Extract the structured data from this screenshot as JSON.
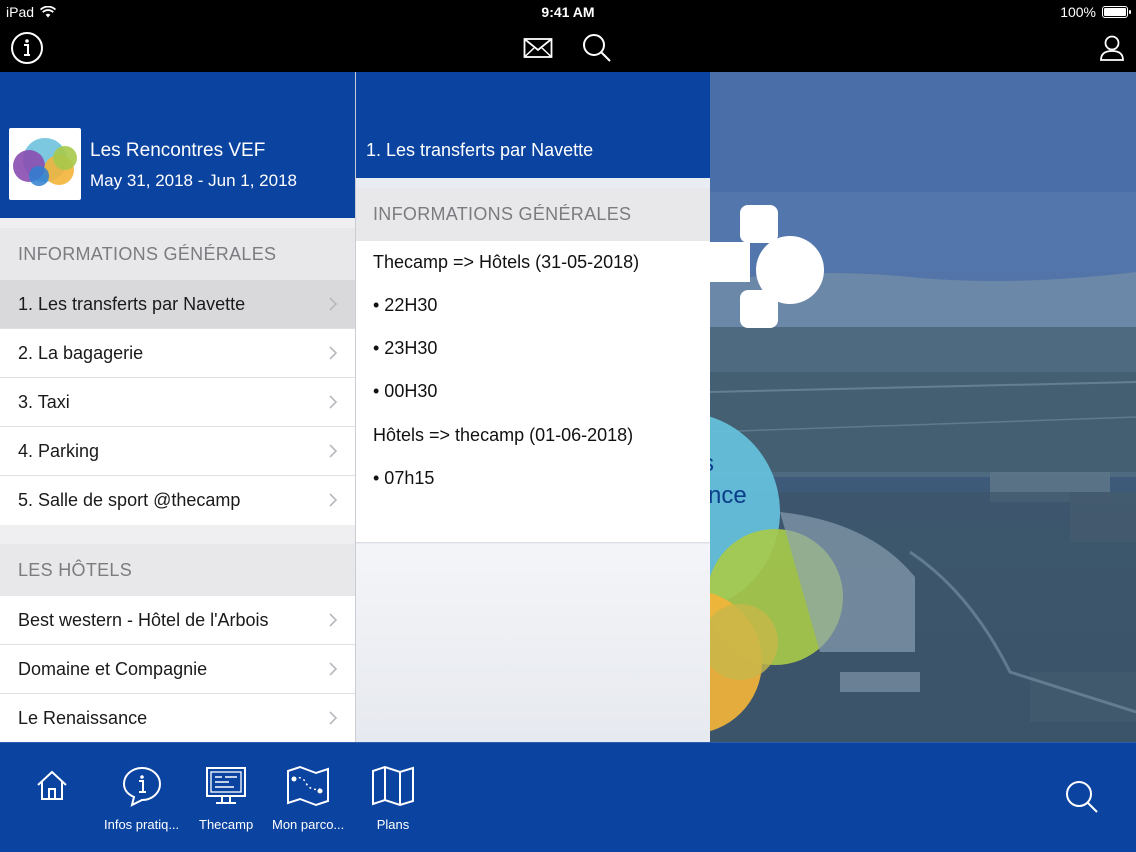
{
  "status_bar": {
    "device": "iPad",
    "time": "9:41 AM",
    "battery": "100%"
  },
  "top_nav": {
    "icons": [
      "info-icon",
      "mail-icon",
      "search-icon",
      "user-icon"
    ]
  },
  "event": {
    "title": "Les Rencontres VEF",
    "dates": "May 31, 2018 - Jun 1, 2018"
  },
  "left_list": {
    "sections": [
      {
        "header": "INFORMATIONS GÉNÉRALES",
        "items": [
          "1. Les transferts par Navette",
          "2. La bagagerie",
          "3. Taxi",
          "4. Parking",
          "5. Salle de sport @thecamp"
        ]
      },
      {
        "header": "LES HÔTELS",
        "items": [
          "Best western - Hôtel de l'Arbois",
          "Domaine et Compagnie",
          "Le Renaissance"
        ]
      }
    ],
    "selected_index": 0
  },
  "detail": {
    "title": "1. Les transferts par Navette",
    "section": "INFORMATIONS GÉNÉRALES",
    "lines": [
      "Thecamp => Hôtels (31-05-2018)",
      "• 22H30",
      "• 23H30",
      "• 00H30",
      "Hôtels => thecamp (01-06-2018)",
      "• 07h15"
    ]
  },
  "background": {
    "partial_text_1": "s",
    "partial_text_2": "nce"
  },
  "tab_bar": {
    "tabs": [
      {
        "icon": "home-icon",
        "label": ""
      },
      {
        "icon": "info-bubble-icon",
        "label": "Infos pratiq..."
      },
      {
        "icon": "screen-icon",
        "label": "Thecamp"
      },
      {
        "icon": "route-map-icon",
        "label": "Mon parco..."
      },
      {
        "icon": "folded-map-icon",
        "label": "Plans"
      }
    ],
    "search_icon": "search-icon"
  },
  "colors": {
    "brand_blue": "#0a43a0",
    "section_gray": "#e8e8ea",
    "selected_row": "#d9d9dc"
  }
}
